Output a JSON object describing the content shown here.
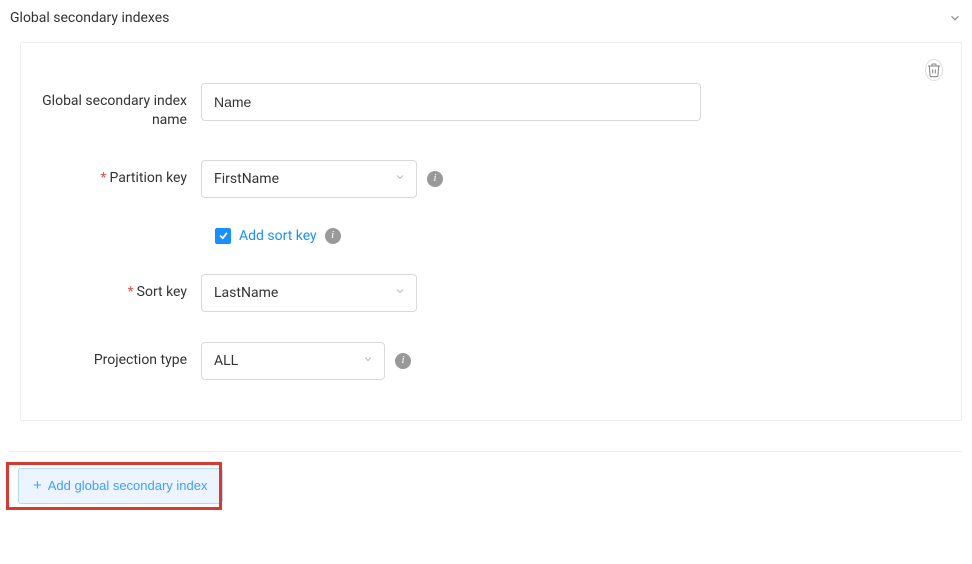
{
  "header": {
    "title": "Global secondary indexes"
  },
  "form": {
    "index_name_label": "Global secondary index name",
    "index_name_value": "Name",
    "partition_key_label": "Partition key",
    "partition_key_value": "FirstName",
    "add_sort_key_label": "Add sort key",
    "sort_key_label": "Sort key",
    "sort_key_value": "LastName",
    "projection_type_label": "Projection type",
    "projection_type_value": "ALL"
  },
  "actions": {
    "add_button_label": "Add global secondary index"
  }
}
